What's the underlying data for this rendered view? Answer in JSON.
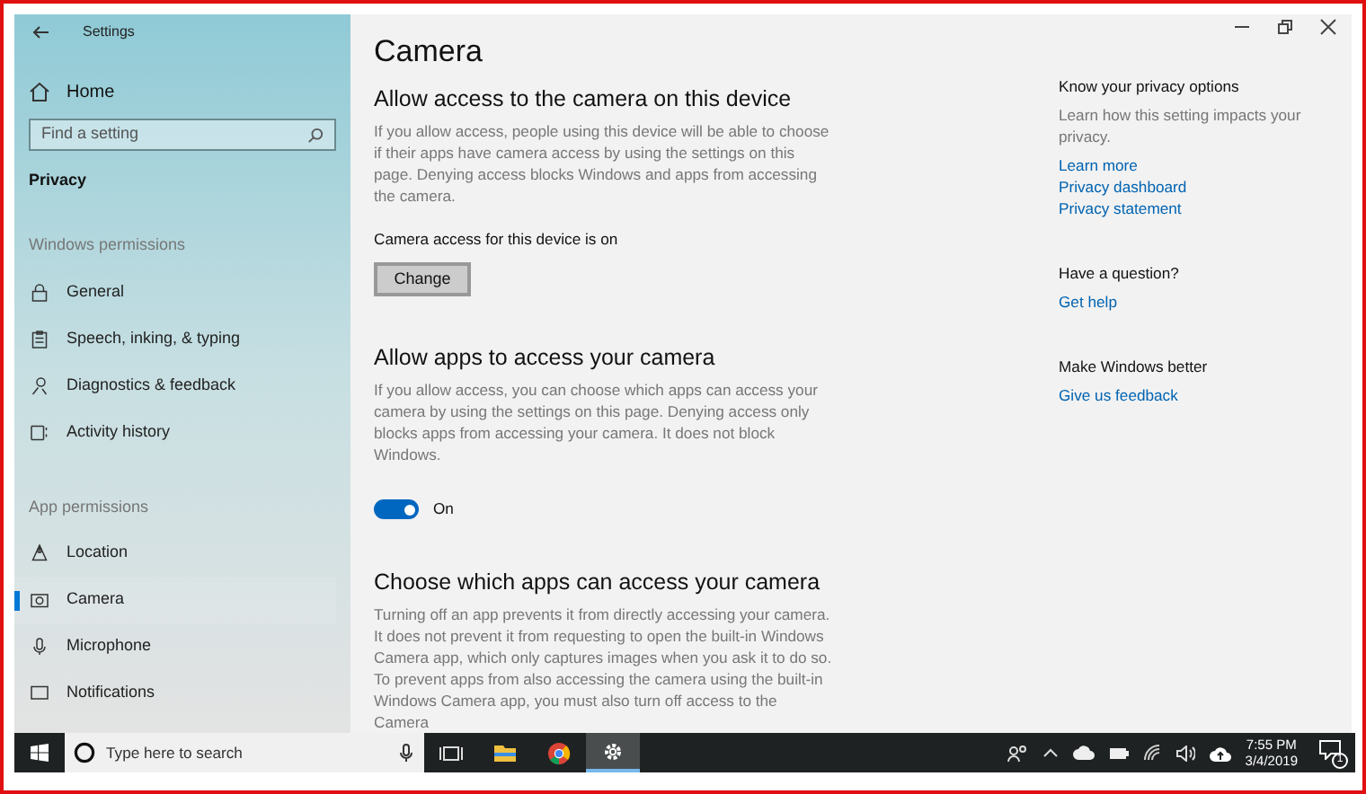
{
  "window": {
    "title": "Settings"
  },
  "sidebar": {
    "home": "Home",
    "search": {
      "placeholder": "Find a setting"
    },
    "section": "Privacy",
    "groups": [
      {
        "heading": "Windows permissions",
        "items": [
          {
            "label": "General",
            "kind": "lock",
            "selected": false
          },
          {
            "label": "Speech, inking, & typing",
            "kind": "clipboard",
            "selected": false
          },
          {
            "label": "Diagnostics & feedback",
            "kind": "person",
            "selected": false
          },
          {
            "label": "Activity history",
            "kind": "timeline",
            "selected": false
          }
        ]
      },
      {
        "heading": "App permissions",
        "items": [
          {
            "label": "Location",
            "kind": "location",
            "selected": false
          },
          {
            "label": "Camera",
            "kind": "camera",
            "selected": true
          },
          {
            "label": "Microphone",
            "kind": "mic",
            "selected": false
          },
          {
            "label": "Notifications",
            "kind": "message",
            "selected": false
          }
        ]
      }
    ]
  },
  "main": {
    "title": "Camera",
    "sections": [
      {
        "kind": "button",
        "heading": "Allow access to the camera on this device",
        "description": "If you allow access, people using this device will be able to choose if their apps have camera access by using the settings on this page. Denying access blocks Windows and apps from accessing the camera.",
        "status": "Camera access for this device is on",
        "button": "Change"
      },
      {
        "kind": "toggle",
        "heading": "Allow apps to access your camera",
        "description": "If you allow access, you can choose which apps can access your camera by using the settings on this page. Denying access only blocks apps from accessing your camera. It does not block Windows.",
        "toggle": {
          "on": true,
          "label": "On"
        }
      },
      {
        "kind": "text",
        "heading": "Choose which apps can access your camera",
        "description": "Turning off an app prevents it from directly accessing your camera. It does not prevent it from requesting to open the built-in Windows Camera app, which only captures images when you ask it to do so. To prevent apps from also accessing the camera using the built-in Windows Camera app, you must also turn off access to the Camera"
      }
    ]
  },
  "aside": [
    {
      "heading": "Know your privacy options",
      "description": "Learn how this setting impacts your privacy.",
      "links": [
        "Learn more",
        "Privacy dashboard",
        "Privacy statement"
      ]
    },
    {
      "heading": "Have a question?",
      "links": [
        "Get help"
      ]
    },
    {
      "heading": "Make Windows better",
      "links": [
        "Give us feedback"
      ]
    }
  ],
  "taskbar": {
    "search": {
      "placeholder": "Type here to search"
    },
    "apps": [
      {
        "kind": "taskview",
        "selected": false
      },
      {
        "kind": "folder",
        "selected": false
      },
      {
        "kind": "chrome",
        "selected": false
      },
      {
        "kind": "gear",
        "selected": true
      }
    ],
    "time": "7:55 PM",
    "date": "3/4/2019",
    "notifications": "1"
  }
}
